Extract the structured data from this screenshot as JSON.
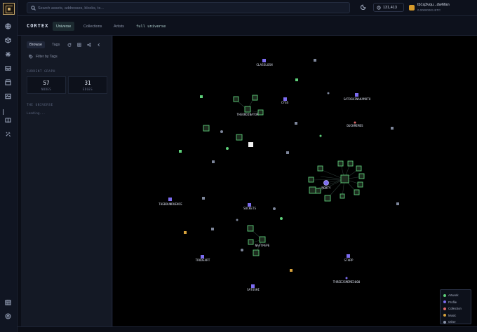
{
  "topbar": {
    "search_placeholder": "Search assets, addresses, blocks, tx...",
    "balance": "131,413",
    "wallet_name": "tb1q3vqu...dw6fan",
    "wallet_sub": "0.00000001 BTC"
  },
  "cortex": {
    "title": "CORTEX",
    "tabs": [
      "Universe",
      "Collections",
      "Artists"
    ],
    "active_tab": "Universe",
    "mode": "full universe"
  },
  "panel": {
    "tabs": [
      "Browse",
      "Tags"
    ],
    "filter_label": "Filter by Tags",
    "current_graph_label": "CURRENT GRAPH",
    "stats": [
      {
        "value": "57",
        "label": "NODES"
      },
      {
        "value": "31",
        "label": "EDGES"
      }
    ],
    "universe_label": "THE UNIVERSE",
    "loading": "Loading..."
  },
  "graph": {
    "node_labels": [
      "CLASSLOSH",
      "CYGS",
      "SATOSHINAKAMOTO",
      "THEORDINATOR",
      "DUCKMEMES",
      "MORTY",
      "THEBOUNDUENCE",
      "SOCKETS",
      "NAFTPEPE",
      "TRODEART",
      "STARP",
      "THREEJSMEME3000",
      "SATOSHI"
    ]
  },
  "legend": [
    {
      "label": "Artwork",
      "color": "#5ed07a"
    },
    {
      "label": "Profile",
      "color": "#7c6cf0"
    },
    {
      "label": "Collection",
      "color": "#e06a6a"
    },
    {
      "label": "Music",
      "color": "#d7a23c"
    },
    {
      "label": "Other",
      "color": "#8a93a8"
    }
  ]
}
